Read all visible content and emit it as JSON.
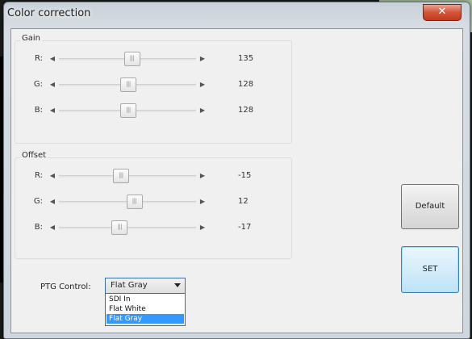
{
  "window": {
    "title": "Color correction",
    "close_glyph": "✕"
  },
  "gain": {
    "label": "Gain",
    "rows": [
      {
        "channel": "R:",
        "value": "135",
        "level": 0.53
      },
      {
        "channel": "G:",
        "value": "128",
        "level": 0.5
      },
      {
        "channel": "B:",
        "value": "128",
        "level": 0.5
      }
    ]
  },
  "offset": {
    "label": "Offset",
    "rows": [
      {
        "channel": "R:",
        "value": "-15",
        "level": 0.44
      },
      {
        "channel": "G:",
        "value": "12",
        "level": 0.55
      },
      {
        "channel": "B:",
        "value": "-17",
        "level": 0.43
      }
    ]
  },
  "buttons": {
    "default": "Default",
    "set": "SET"
  },
  "ptg": {
    "label": "PTG Control:",
    "selected": "Flat Gray",
    "options": [
      "SDI In",
      "Flat White",
      "Flat Gray"
    ],
    "highlighted_index": 2
  },
  "colors": {
    "selection": "#3399ff",
    "close_button": "#c7442b",
    "set_button": "#bde4f8"
  },
  "icons": {
    "slider_left": "◀",
    "slider_right": "▶",
    "thumb_grip": "|||",
    "dropdown": "triangle-down"
  }
}
